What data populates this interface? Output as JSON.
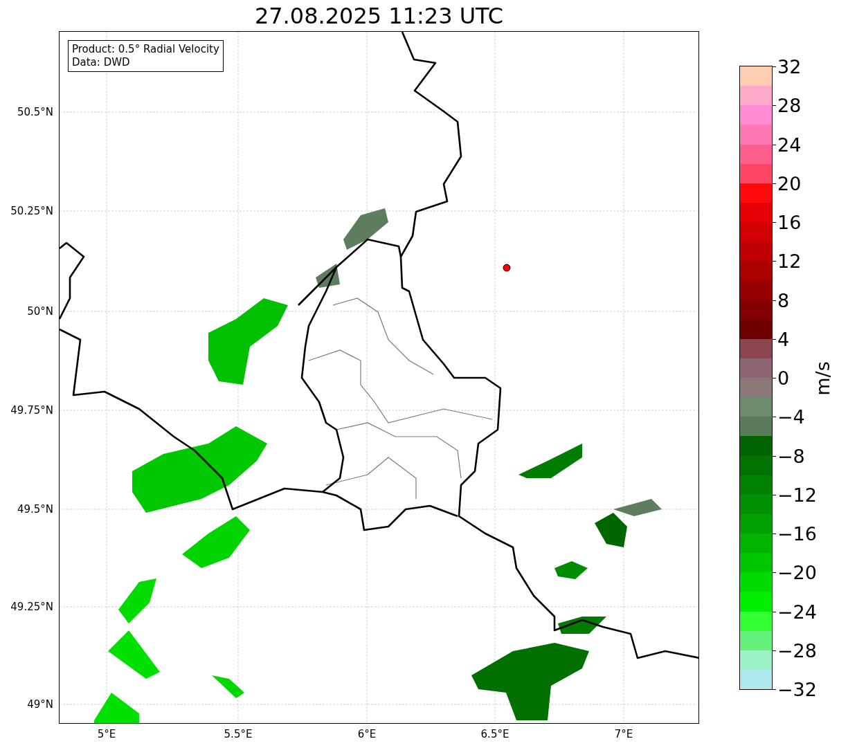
{
  "title": "27.08.2025 11:23 UTC",
  "info_box": {
    "lines": [
      "Product: 0.5° Radial Velocity",
      "Data: DWD"
    ]
  },
  "map": {
    "x_ticks": [
      "5°E",
      "5.5°E",
      "6°E",
      "6.5°E",
      "7°E"
    ],
    "y_ticks": [
      "50.5°N",
      "50.25°N",
      "50°N",
      "49.75°N",
      "49.5°N",
      "49.25°N",
      "49°N"
    ]
  },
  "colorbar": {
    "ticks": [
      "32",
      "28",
      "24",
      "20",
      "16",
      "12",
      "8",
      "4",
      "0",
      "−4",
      "−8",
      "−12",
      "−16",
      "−20",
      "−24",
      "−28",
      "−32"
    ],
    "label": "m/s"
  }
}
